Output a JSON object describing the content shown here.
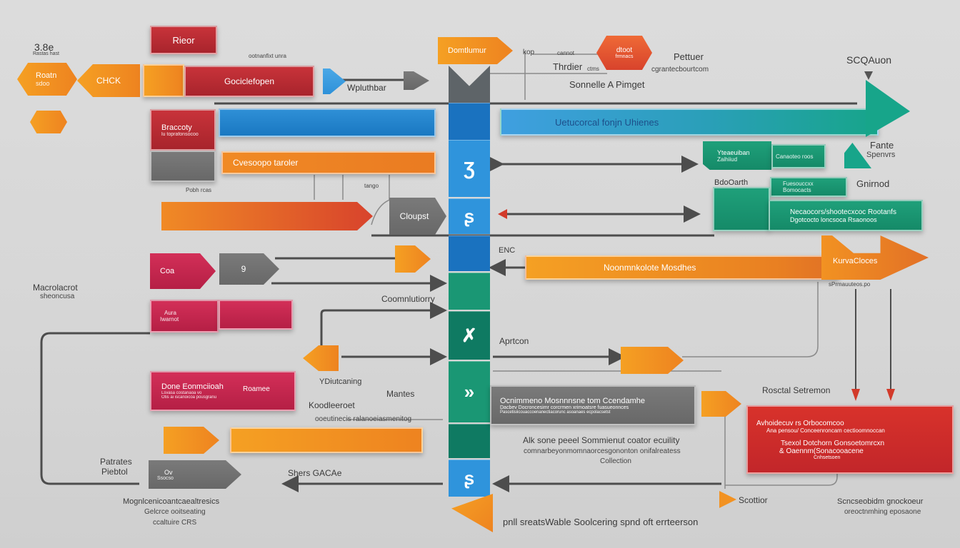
{
  "colors": {
    "red": "#b8292f",
    "crimson": "#c92650",
    "orange": "#f29222",
    "grey": "#6f6f6f",
    "blue": "#2385cf",
    "green": "#1a9774",
    "teal": "#17a58a",
    "background": "#d8d8d8"
  },
  "top_left": {
    "version_label": "3.8e",
    "version_sub": "Rastas hast",
    "hex_start": {
      "title": "Roatn",
      "sub": "sdoo"
    },
    "click_arrow": "CHCK",
    "reat_box": "Rieor",
    "gocle_box": "Gociclefopen",
    "gocle_caption": "ootnanfixt unra",
    "wp_label": "Wpluthbar"
  },
  "top_center": {
    "dom_tag": "Domtlumur",
    "hex_red": {
      "title": "dtoot",
      "sub": "frmnacs"
    },
    "connector_label": "kop",
    "connector_mid": "cannot",
    "thr_label": "Thrdier",
    "thr_sub": "ctms",
    "sonnelle_label": "Sonnelle A  Pimget",
    "pettuer_label": "Pettuer",
    "pettuer_sub": "cgrantecbourtcom"
  },
  "top_right": {
    "sqa_label": "SCQAuon",
    "teal_arrow_text": "Uetucorcal fonjn Uhienes",
    "fante_label": "Fante",
    "fante_sub": "Spenvrs",
    "green_box_1": {
      "title": "Yteaeuiban",
      "sub": "Zaihiiud"
    },
    "green_box_2": {
      "sub": "Canaoteo roos"
    },
    "bdo_label": "BdoOarth",
    "green_box_3": {
      "title": "Fuesouccxx",
      "sub": "Bomocacts"
    },
    "gnirnod_label": "Gnirnod",
    "green_box_4": {
      "line1": "Necaocors/shootecxcoc Rootanfs",
      "line2": "Dgotcocto loncsoca Rsaonoos"
    }
  },
  "middle_left": {
    "brov_box": {
      "title": "Braccoty",
      "sub": "lu toprafonsocoo"
    },
    "orange_bar_label": "Cvesoopo taroler",
    "posh_label": "Pobh rcas",
    "tango_label": "tango",
    "cloupst_label": "Cloupst",
    "coa_label": "Coa",
    "grey_arrow_num": "9",
    "macro_label": "Macrolacrot",
    "macro_sub": "sheoncusa",
    "aura_box": {
      "title": "Aura",
      "sub": "Iwarnot"
    },
    "coma_label": "Coomnlutiorry"
  },
  "middle_right": {
    "ene_label": "ENC",
    "orange_arrow_text": "Noonmnkolote Mosdhes",
    "kurnac_label": "KurvaCloces",
    "kurnac_sub": "sPrmauuteos.po",
    "apprin_label": "Aprtcon"
  },
  "spine": {
    "segments": [
      {
        "color": "grey",
        "glyph": ""
      },
      {
        "color": "blue",
        "glyph": ""
      },
      {
        "color": "lblue",
        "glyph": "Ʒ"
      },
      {
        "color": "lblue",
        "glyph": "ʂ"
      },
      {
        "color": "blue",
        "glyph": ""
      },
      {
        "color": "green",
        "glyph": ""
      },
      {
        "color": "dgreen",
        "glyph": "✗"
      },
      {
        "color": "green",
        "glyph": "»"
      },
      {
        "color": "dgreen",
        "glyph": ""
      },
      {
        "color": "lblue",
        "glyph": "ʂ"
      }
    ]
  },
  "bottom_left": {
    "done_box": {
      "title": "Done Eonmciioah",
      "tag": "Roamee",
      "line1": "Lsvasa costanaoa vo",
      "line2": "Otis ai iscanoicoa pousgranu"
    },
    "ydium_label": "YDiutcaning",
    "mantes_label": "Mantes",
    "kood_label": "Koodleeroet",
    "cool_sub": "ooeutinecis ralanoeiasmenitog",
    "patrates_label": "Patrates",
    "patrates_sub": "Piebtol",
    "ov_box": {
      "title": "Ov",
      "sub": "Ssocso"
    },
    "magn_line1": "Mognlcenicoantcaealtresics",
    "magn_line2": "Gelcrce ooitseating",
    "magn_line3": "ccaltuire CRS",
    "shers_label": "Shers GACAe"
  },
  "bottom_center": {
    "grey_panel": {
      "title": "Ocnimmeno Mosnnnsne tom Ccendamhe",
      "line1": "Dacbev Docroncesimr corcrmen xrimoatsre fuasueonnces",
      "line2": "Pascetisiicouaccoenanectiacorunc asoanaes ecpolacsetst"
    },
    "alk_line1": "Alk sone peeel Sommienut coator ecuility",
    "alk_line2": "comnarbeyonmomnaorcesgononton onifalreatess",
    "alk_line3": "Collection",
    "pnli_line": "pnll sreatsWable Soolcering spnd oft errteerson"
  },
  "bottom_right": {
    "roncal_label": "Rosctal Setremon",
    "red_panel": {
      "line1": "Avhoidecuv rs Orbocomcoo",
      "line2": "Ana pensou/  Conceenroncam cectioomnoccan",
      "line3": "Tsexol Dotchorn Gonsoetomrcxn",
      "line4": "& Oaennm(Sonacooacene",
      "line5": "Cnhsetsoen"
    },
    "scotto_label": "Scottior",
    "scr_line1": "Scncseobidm gnockoeur",
    "scr_line2": "oreoctnmhing eposaone"
  }
}
